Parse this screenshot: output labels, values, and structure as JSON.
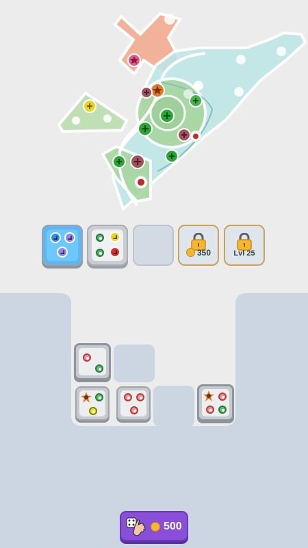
{
  "tray": {
    "slots": [
      {
        "state": "filled",
        "theme": "blue"
      },
      {
        "state": "filled",
        "theme": "gray"
      },
      {
        "state": "empty"
      },
      {
        "state": "locked",
        "label": "350",
        "icon": "coin-icon"
      },
      {
        "state": "locked",
        "label": "Lvl 25"
      }
    ]
  },
  "board": {},
  "buy_button": {
    "label": "500",
    "icons": [
      "dice-hand-icon",
      "coin-icon"
    ]
  },
  "colors": {
    "background": "#ececec",
    "board": "#ccd6e2",
    "purple_button": "#8a4fd8",
    "coin": "#f5b731",
    "lock": "#f5b731"
  }
}
